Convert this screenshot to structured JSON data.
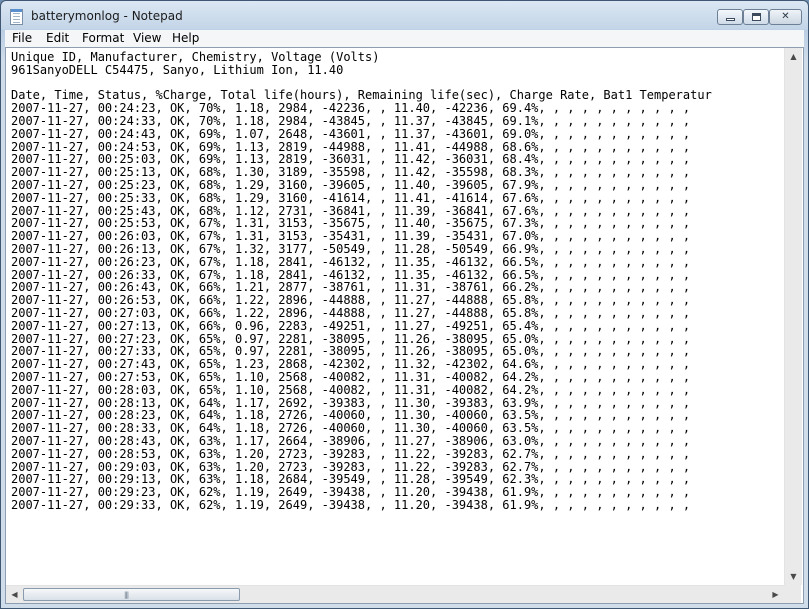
{
  "window": {
    "title": "batterymonlog - Notepad"
  },
  "menu": [
    "File",
    "Edit",
    "Format",
    "View",
    "Help"
  ],
  "editor": {
    "lines": [
      "Unique ID, Manufacturer, Chemistry, Voltage (Volts)",
      "961SanyoDELL C54475, Sanyo, Lithium Ion, 11.40",
      "",
      "Date, Time, Status, %Charge, Total life(hours), Remaining life(sec), Charge Rate, Bat1 Temperatur",
      "2007-11-27, 00:24:23, OK, 70%, 1.18, 2984, -42236, , 11.40, -42236, 69.4%, , , , , , , , , , ,",
      "2007-11-27, 00:24:33, OK, 70%, 1.18, 2984, -43845, , 11.37, -43845, 69.1%, , , , , , , , , , ,",
      "2007-11-27, 00:24:43, OK, 69%, 1.07, 2648, -43601, , 11.37, -43601, 69.0%, , , , , , , , , , ,",
      "2007-11-27, 00:24:53, OK, 69%, 1.13, 2819, -44988, , 11.41, -44988, 68.6%, , , , , , , , , , ,",
      "2007-11-27, 00:25:03, OK, 69%, 1.13, 2819, -36031, , 11.42, -36031, 68.4%, , , , , , , , , , ,",
      "2007-11-27, 00:25:13, OK, 68%, 1.30, 3189, -35598, , 11.42, -35598, 68.3%, , , , , , , , , , ,",
      "2007-11-27, 00:25:23, OK, 68%, 1.29, 3160, -39605, , 11.40, -39605, 67.9%, , , , , , , , , , ,",
      "2007-11-27, 00:25:33, OK, 68%, 1.29, 3160, -41614, , 11.41, -41614, 67.6%, , , , , , , , , , ,",
      "2007-11-27, 00:25:43, OK, 68%, 1.12, 2731, -36841, , 11.39, -36841, 67.6%, , , , , , , , , , ,",
      "2007-11-27, 00:25:53, OK, 67%, 1.31, 3153, -35675, , 11.40, -35675, 67.3%, , , , , , , , , , ,",
      "2007-11-27, 00:26:03, OK, 67%, 1.31, 3153, -35431, , 11.39, -35431, 67.0%, , , , , , , , , , ,",
      "2007-11-27, 00:26:13, OK, 67%, 1.32, 3177, -50549, , 11.28, -50549, 66.9%, , , , , , , , , , ,",
      "2007-11-27, 00:26:23, OK, 67%, 1.18, 2841, -46132, , 11.35, -46132, 66.5%, , , , , , , , , , ,",
      "2007-11-27, 00:26:33, OK, 67%, 1.18, 2841, -46132, , 11.35, -46132, 66.5%, , , , , , , , , , ,",
      "2007-11-27, 00:26:43, OK, 66%, 1.21, 2877, -38761, , 11.31, -38761, 66.2%, , , , , , , , , , ,",
      "2007-11-27, 00:26:53, OK, 66%, 1.22, 2896, -44888, , 11.27, -44888, 65.8%, , , , , , , , , , ,",
      "2007-11-27, 00:27:03, OK, 66%, 1.22, 2896, -44888, , 11.27, -44888, 65.8%, , , , , , , , , , ,",
      "2007-11-27, 00:27:13, OK, 66%, 0.96, 2283, -49251, , 11.27, -49251, 65.4%, , , , , , , , , , ,",
      "2007-11-27, 00:27:23, OK, 65%, 0.97, 2281, -38095, , 11.26, -38095, 65.0%, , , , , , , , , , ,",
      "2007-11-27, 00:27:33, OK, 65%, 0.97, 2281, -38095, , 11.26, -38095, 65.0%, , , , , , , , , , ,",
      "2007-11-27, 00:27:43, OK, 65%, 1.23, 2868, -42302, , 11.32, -42302, 64.6%, , , , , , , , , , ,",
      "2007-11-27, 00:27:53, OK, 65%, 1.10, 2568, -40082, , 11.31, -40082, 64.2%, , , , , , , , , , ,",
      "2007-11-27, 00:28:03, OK, 65%, 1.10, 2568, -40082, , 11.31, -40082, 64.2%, , , , , , , , , , ,",
      "2007-11-27, 00:28:13, OK, 64%, 1.17, 2692, -39383, , 11.30, -39383, 63.9%, , , , , , , , , , ,",
      "2007-11-27, 00:28:23, OK, 64%, 1.18, 2726, -40060, , 11.30, -40060, 63.5%, , , , , , , , , , ,",
      "2007-11-27, 00:28:33, OK, 64%, 1.18, 2726, -40060, , 11.30, -40060, 63.5%, , , , , , , , , , ,",
      "2007-11-27, 00:28:43, OK, 63%, 1.17, 2664, -38906, , 11.27, -38906, 63.0%, , , , , , , , , , ,",
      "2007-11-27, 00:28:53, OK, 63%, 1.20, 2723, -39283, , 11.22, -39283, 62.7%, , , , , , , , , , ,",
      "2007-11-27, 00:29:03, OK, 63%, 1.20, 2723, -39283, , 11.22, -39283, 62.7%, , , , , , , , , , ,",
      "2007-11-27, 00:29:13, OK, 63%, 1.18, 2684, -39549, , 11.28, -39549, 62.3%, , , , , , , , , , ,",
      "2007-11-27, 00:29:23, OK, 62%, 1.19, 2649, -39438, , 11.20, -39438, 61.9%, , , , , , , , , , ,",
      "2007-11-27, 00:29:33, OK, 62%, 1.19, 2649, -39438, , 11.20, -39438, 61.9%, , , , , , , , , , ,"
    ]
  },
  "icons": {
    "app": "notepad-icon",
    "minimize": "minimize-icon",
    "maximize": "maximize-icon",
    "close": "close-icon",
    "scroll_up": "arrow-up-icon",
    "scroll_down": "arrow-down-icon",
    "scroll_left": "arrow-left-icon",
    "scroll_right": "arrow-right-icon"
  },
  "colors": {
    "title_bar": "#c3d5e8",
    "menu_bar": "#f5f6f7",
    "editor_bg": "#ffffff",
    "text": "#000000"
  }
}
